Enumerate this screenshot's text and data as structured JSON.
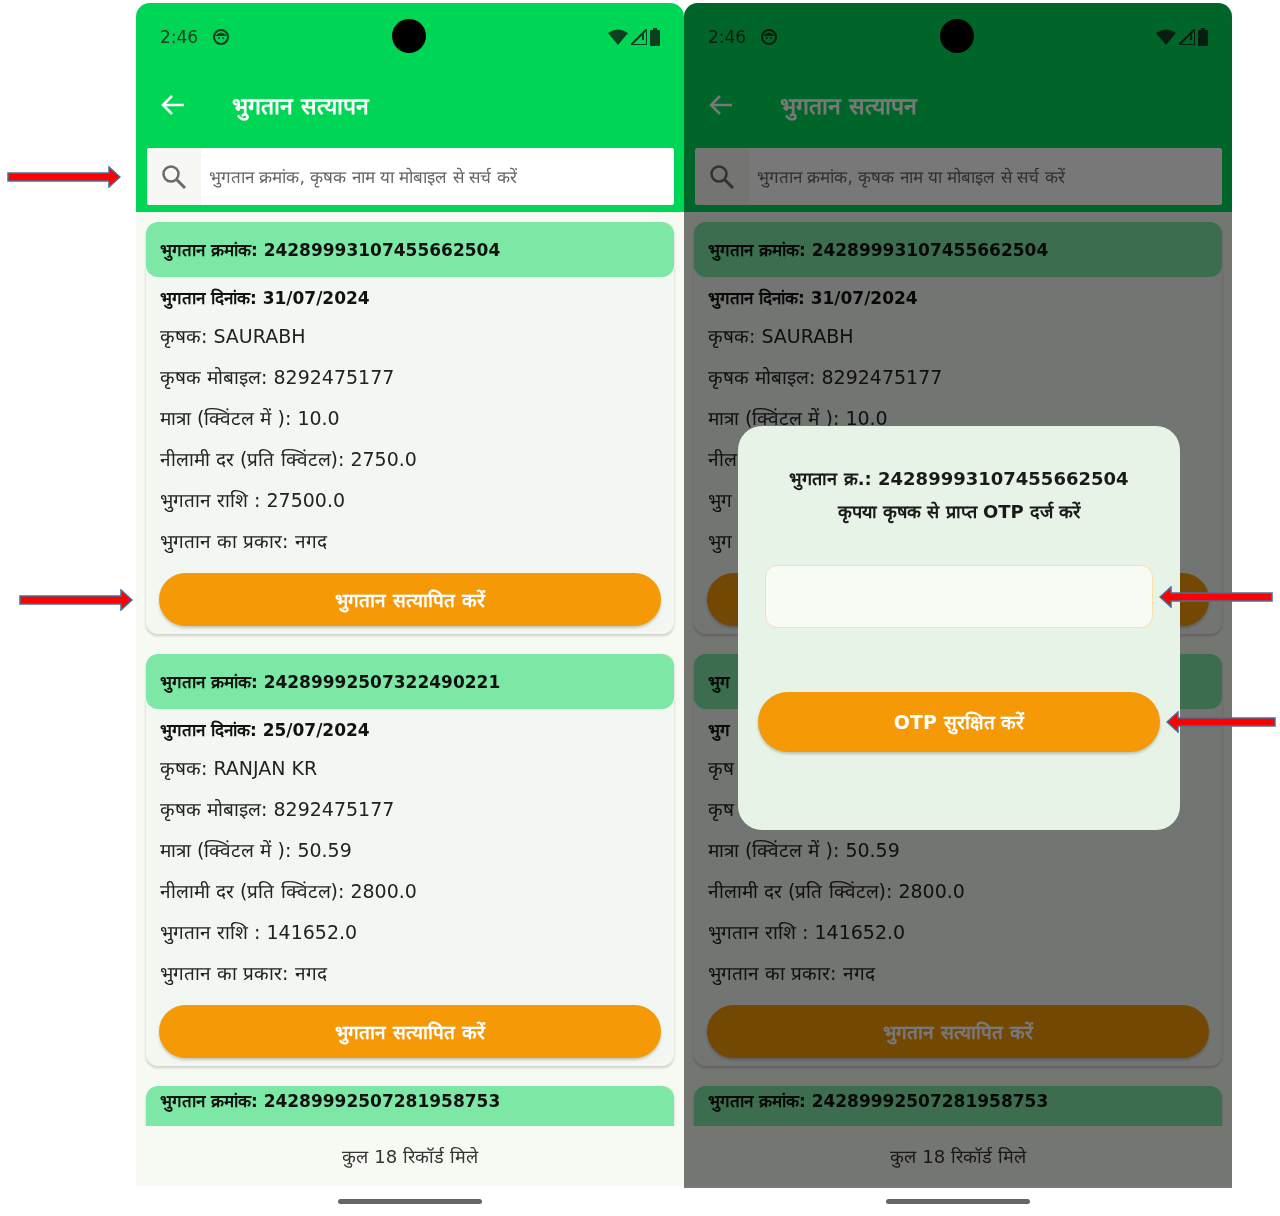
{
  "screens": [
    {
      "dimmed": false,
      "status_bar": {
        "time": "2:46"
      },
      "app_bar": {
        "title": "भुगतान सत्यापन"
      },
      "search": {
        "placeholder": "भुगतान क्रमांक, कृषक नाम या मोबाइल से सर्च करें",
        "marked": true
      },
      "records": [
        {
          "header": "भुगतान क्रमांक: 24289993107455662504",
          "fields": [
            {
              "kind": "strong",
              "text": "भुगतान दिनांक: 31/07/2024"
            },
            {
              "kind": "plain",
              "text": "कृषक: SAURABH"
            },
            {
              "kind": "plain",
              "text": "कृषक मोबाइल: 8292475177"
            },
            {
              "kind": "plain",
              "text": "मात्रा (क्विंटल में ): 10.0"
            },
            {
              "kind": "plain",
              "text": "नीलामी दर (प्रति क्विंटल): 2750.0"
            },
            {
              "kind": "plain",
              "text": "भुगतान राशि : 27500.0"
            },
            {
              "kind": "plain",
              "text": "भुगतान का प्रकार: नगद"
            }
          ],
          "button": {
            "label": "भुगतान सत्यापित करें",
            "marked": true
          }
        },
        {
          "header": "भुगतान क्रमांक: 24289992507322490221",
          "fields": [
            {
              "kind": "strong",
              "text": "भुगतान दिनांक: 25/07/2024"
            },
            {
              "kind": "plain",
              "text": "कृषक: RANJAN KR"
            },
            {
              "kind": "plain",
              "text": "कृषक मोबाइल: 8292475177"
            },
            {
              "kind": "plain",
              "text": "मात्रा (क्विंटल में ): 50.59"
            },
            {
              "kind": "plain",
              "text": "नीलामी दर (प्रति क्विंटल): 2800.0"
            },
            {
              "kind": "plain",
              "text": "भुगतान राशि : 141652.0"
            },
            {
              "kind": "plain",
              "text": "भुगतान का प्रकार: नगद"
            }
          ],
          "button": {
            "label": "भुगतान सत्यापित करें",
            "marked": false
          }
        },
        {
          "header": "भुगतान क्रमांक: 24289992507281958753"
        }
      ],
      "footer": "कुल 18 रिकॉर्ड मिले"
    },
    {
      "dimmed": true,
      "status_bar": {
        "time": "2:46"
      },
      "app_bar": {
        "title": "भुगतान सत्यापन"
      },
      "search": {
        "placeholder": "भुगतान क्रमांक, कृषक नाम या मोबाइल से सर्च करें",
        "marked": false
      },
      "records": [
        {
          "header": "भुगतान क्रमांक: 24289993107455662504",
          "fields": [
            {
              "kind": "strong",
              "text": "भुगतान दिनांक: 31/07/2024"
            },
            {
              "kind": "plain",
              "text": "कृषक: SAURABH"
            },
            {
              "kind": "plain",
              "text": "कृषक मोबाइल: 8292475177"
            },
            {
              "kind": "plain",
              "text": "मात्रा (क्विंटल में ): 10.0"
            },
            {
              "kind": "plain",
              "text": "नील"
            },
            {
              "kind": "plain",
              "text": "भुग"
            },
            {
              "kind": "plain",
              "text": "भुग"
            }
          ],
          "has_button": true
        },
        {
          "header": "भुग",
          "fields": [
            {
              "kind": "strong",
              "text": "भुग"
            },
            {
              "kind": "plain",
              "text": "कृष"
            },
            {
              "kind": "plain",
              "text": "कृष"
            },
            {
              "kind": "plain",
              "text": "मात्रा (क्विंटल में ): 50.59"
            },
            {
              "kind": "plain",
              "text": "नीलामी दर (प्रति क्विंटल): 2800.0"
            },
            {
              "kind": "plain",
              "text": "भुगतान राशि : 141652.0"
            },
            {
              "kind": "plain",
              "text": "भुगतान का प्रकार: नगद"
            }
          ],
          "button": {
            "label": "भुगतान सत्यापित करें",
            "marked": false
          }
        },
        {
          "header": "भुगतान क्रमांक: 24289992507281958753"
        }
      ],
      "footer": "कुल 18 रिकॉर्ड मिले",
      "dialog": {
        "title": "भुगतान क्र.: 24289993107455662504",
        "message": "कृपया कृषक से प्राप्त **OTP** दर्ज करें",
        "field_marked": true,
        "button": {
          "label": "OTP सुरक्षित करें",
          "marked": true
        }
      }
    }
  ]
}
